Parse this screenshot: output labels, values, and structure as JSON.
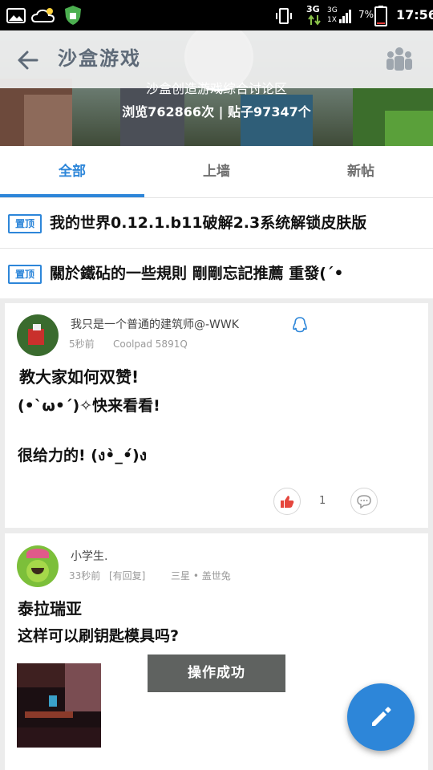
{
  "status_bar": {
    "network": "3G",
    "network2": "3G",
    "signal_sub": "1X",
    "battery": "7%",
    "time": "17:56"
  },
  "header": {
    "title": "沙盒游戏",
    "subtitle": "沙盒创造游戏综合讨论区",
    "stats": "浏览762866次 | 贴子97347个"
  },
  "tabs": [
    {
      "label": "全部",
      "active": true
    },
    {
      "label": "上墙",
      "active": false
    },
    {
      "label": "新帖",
      "active": false
    }
  ],
  "pinned": [
    {
      "badge": "置顶",
      "title": "我的世界0.12.1.b11破解2.3系统解锁皮肤版"
    },
    {
      "badge": "置顶",
      "title": "關於鐵砧的一些規則 剛剛忘記推薦 重發(´•"
    }
  ],
  "posts": [
    {
      "username": "我只是一个普通的建筑师@-WWK",
      "time": "5秒前",
      "device": "Coolpad 5891Q",
      "title": "教大家如何双赞!",
      "body": [
        "(•`ω•´)✧快来看看!",
        "",
        "很给力的! (ง•̀_•́)ง"
      ],
      "likes": "1"
    },
    {
      "username": "小学生.",
      "time": "33秒前",
      "reply_status": "[有回复]",
      "device": "三星 • 盖世兔",
      "title": "泰拉瑞亚",
      "body": [
        "这样可以刷钥匙模具吗?"
      ]
    }
  ],
  "toast": "操作成功",
  "colors": {
    "accent": "#2d86d9",
    "like": "#e5463d"
  }
}
